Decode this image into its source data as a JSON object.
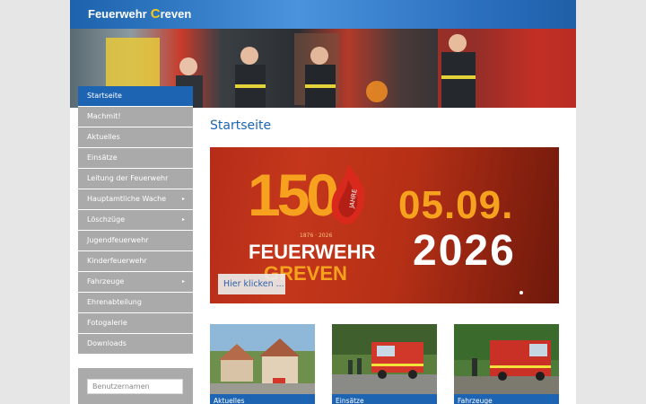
{
  "header": {
    "logo_text": "Feuerwehr",
    "logo_accent": "C",
    "logo_rest": "reven"
  },
  "sidebar": {
    "items": [
      {
        "label": "Startseite",
        "active": true,
        "has_submenu": false
      },
      {
        "label": "Machmit!",
        "active": false,
        "has_submenu": false
      },
      {
        "label": "Aktuelles",
        "active": false,
        "has_submenu": false
      },
      {
        "label": "Einsätze",
        "active": false,
        "has_submenu": false
      },
      {
        "label": "Leitung der Feuerwehr",
        "active": false,
        "has_submenu": false
      },
      {
        "label": "Hauptamtliche Wache",
        "active": false,
        "has_submenu": true
      },
      {
        "label": "Löschzüge",
        "active": false,
        "has_submenu": true
      },
      {
        "label": "Jugendfeuerwehr",
        "active": false,
        "has_submenu": false
      },
      {
        "label": "Kinderfeuerwehr",
        "active": false,
        "has_submenu": false
      },
      {
        "label": "Fahrzeuge",
        "active": false,
        "has_submenu": true
      },
      {
        "label": "Ehrenabteilung",
        "active": false,
        "has_submenu": false
      },
      {
        "label": "Fotogalerie",
        "active": false,
        "has_submenu": false
      },
      {
        "label": "Downloads",
        "active": false,
        "has_submenu": false
      }
    ],
    "submenu_arrow": "▸"
  },
  "login": {
    "username_placeholder": "Benutzernamen"
  },
  "main": {
    "title": "Startseite",
    "banner": {
      "number": "150",
      "badge": "JAHRE",
      "years": "1876 · 2026",
      "line1": "FEUERWEHR",
      "line2": "GREVEN",
      "date": "05.09.",
      "year": "2026",
      "button_label": "Hier klicken ..."
    },
    "tiles": [
      {
        "label": "Aktuelles",
        "icon": "town-photo"
      },
      {
        "label": "Einsätze",
        "icon": "fire-truck-photo"
      },
      {
        "label": "Fahrzeuge",
        "icon": "vehicle-photo"
      }
    ]
  },
  "colors": {
    "primary": "#1d64b3",
    "menu_grey": "#aaaaaa",
    "banner_orange": "#f6a21e",
    "banner_red": "#b52c18"
  }
}
